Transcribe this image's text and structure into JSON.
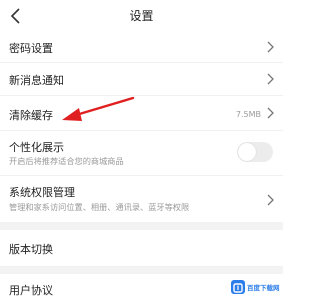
{
  "header": {
    "title": "设置",
    "back_icon": "chevron-left-icon"
  },
  "rows": {
    "password": {
      "label": "密码设置"
    },
    "notifications": {
      "label": "新消息通知"
    },
    "clear_cache": {
      "label": "清除缓存",
      "value": "7.5MB"
    },
    "personalized": {
      "label": "个性化展示",
      "subtitle": "开启后将推荐适合您的商城商品",
      "toggle_on": false
    },
    "permissions": {
      "label": "系统权限管理",
      "subtitle": "管理和家系访问位置、相册、通讯录、蓝牙等权限"
    },
    "version": {
      "label": "版本切换"
    },
    "agreement": {
      "label": "用户协议"
    }
  },
  "annotation": {
    "color": "#e02020"
  },
  "watermark": {
    "text": "百度下载网",
    "color": "#2b7de9"
  }
}
